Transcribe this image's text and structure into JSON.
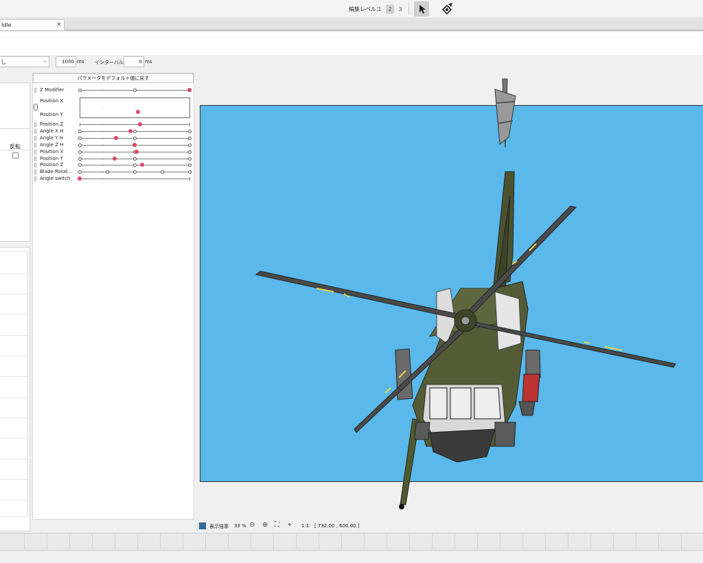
{
  "toolbar": {
    "edit_level_label": "編集レベル：",
    "levels": [
      "1",
      "2",
      "3"
    ],
    "selected_level": "2",
    "tools": [
      "select-arrow-icon",
      "deformer-tool-icon"
    ]
  },
  "tabs": [
    {
      "label": "Idle",
      "close": "×"
    }
  ],
  "playback": {
    "animation_select": "し",
    "duration_value": "1000",
    "duration_unit": "ms",
    "interval_label": "インターバル：",
    "interval_value": "0",
    "interval_unit": "ms"
  },
  "left_panel": {
    "invert_label": "反転",
    "invert_checked": false
  },
  "parameters": {
    "reset_button": "パラメータをデフォルト値に戻す",
    "items": [
      {
        "name": "Z Modifier",
        "keys": [
          0,
          0.5,
          1
        ],
        "value": 1
      },
      {
        "name": "Position X",
        "pair": true
      },
      {
        "name": "Position Y",
        "pair": true,
        "value_x": 0.52,
        "value_y": 0.6
      },
      {
        "name": "Position Z",
        "keys": [],
        "value": 0.55
      },
      {
        "name": "Angle X H",
        "keys": [
          0,
          0.5,
          1
        ],
        "value": 0.46
      },
      {
        "name": "Angle Y H",
        "keys": [
          0,
          0.5,
          1
        ],
        "value": 0.33
      },
      {
        "name": "Angle Z H",
        "keys": [
          0,
          0.5,
          1
        ],
        "value": 0.5
      },
      {
        "name": "Position X",
        "keys": [
          0,
          0.5,
          1
        ],
        "value": 0.52
      },
      {
        "name": "Position Y",
        "keys": [
          0,
          0.5,
          1
        ],
        "value": 0.32
      },
      {
        "name": "Position Z",
        "keys": [
          0,
          0.5,
          1
        ],
        "value": 0.57
      },
      {
        "name": "Blade Rotat...",
        "keys": [
          0,
          0.25,
          0.5,
          0.75,
          1
        ],
        "value": null
      },
      {
        "name": "Angle switch",
        "keys": [],
        "value": 0
      }
    ]
  },
  "status": {
    "zoom_label": "表示倍率",
    "zoom_value": "33 %",
    "ratio_label": "1:1",
    "coords": "[ 732.00 , 600.00 ]"
  },
  "colors": {
    "canvas_bg": "#5ab8ea",
    "param_marker": "#e0456a",
    "accent": "#2e6b9e"
  }
}
